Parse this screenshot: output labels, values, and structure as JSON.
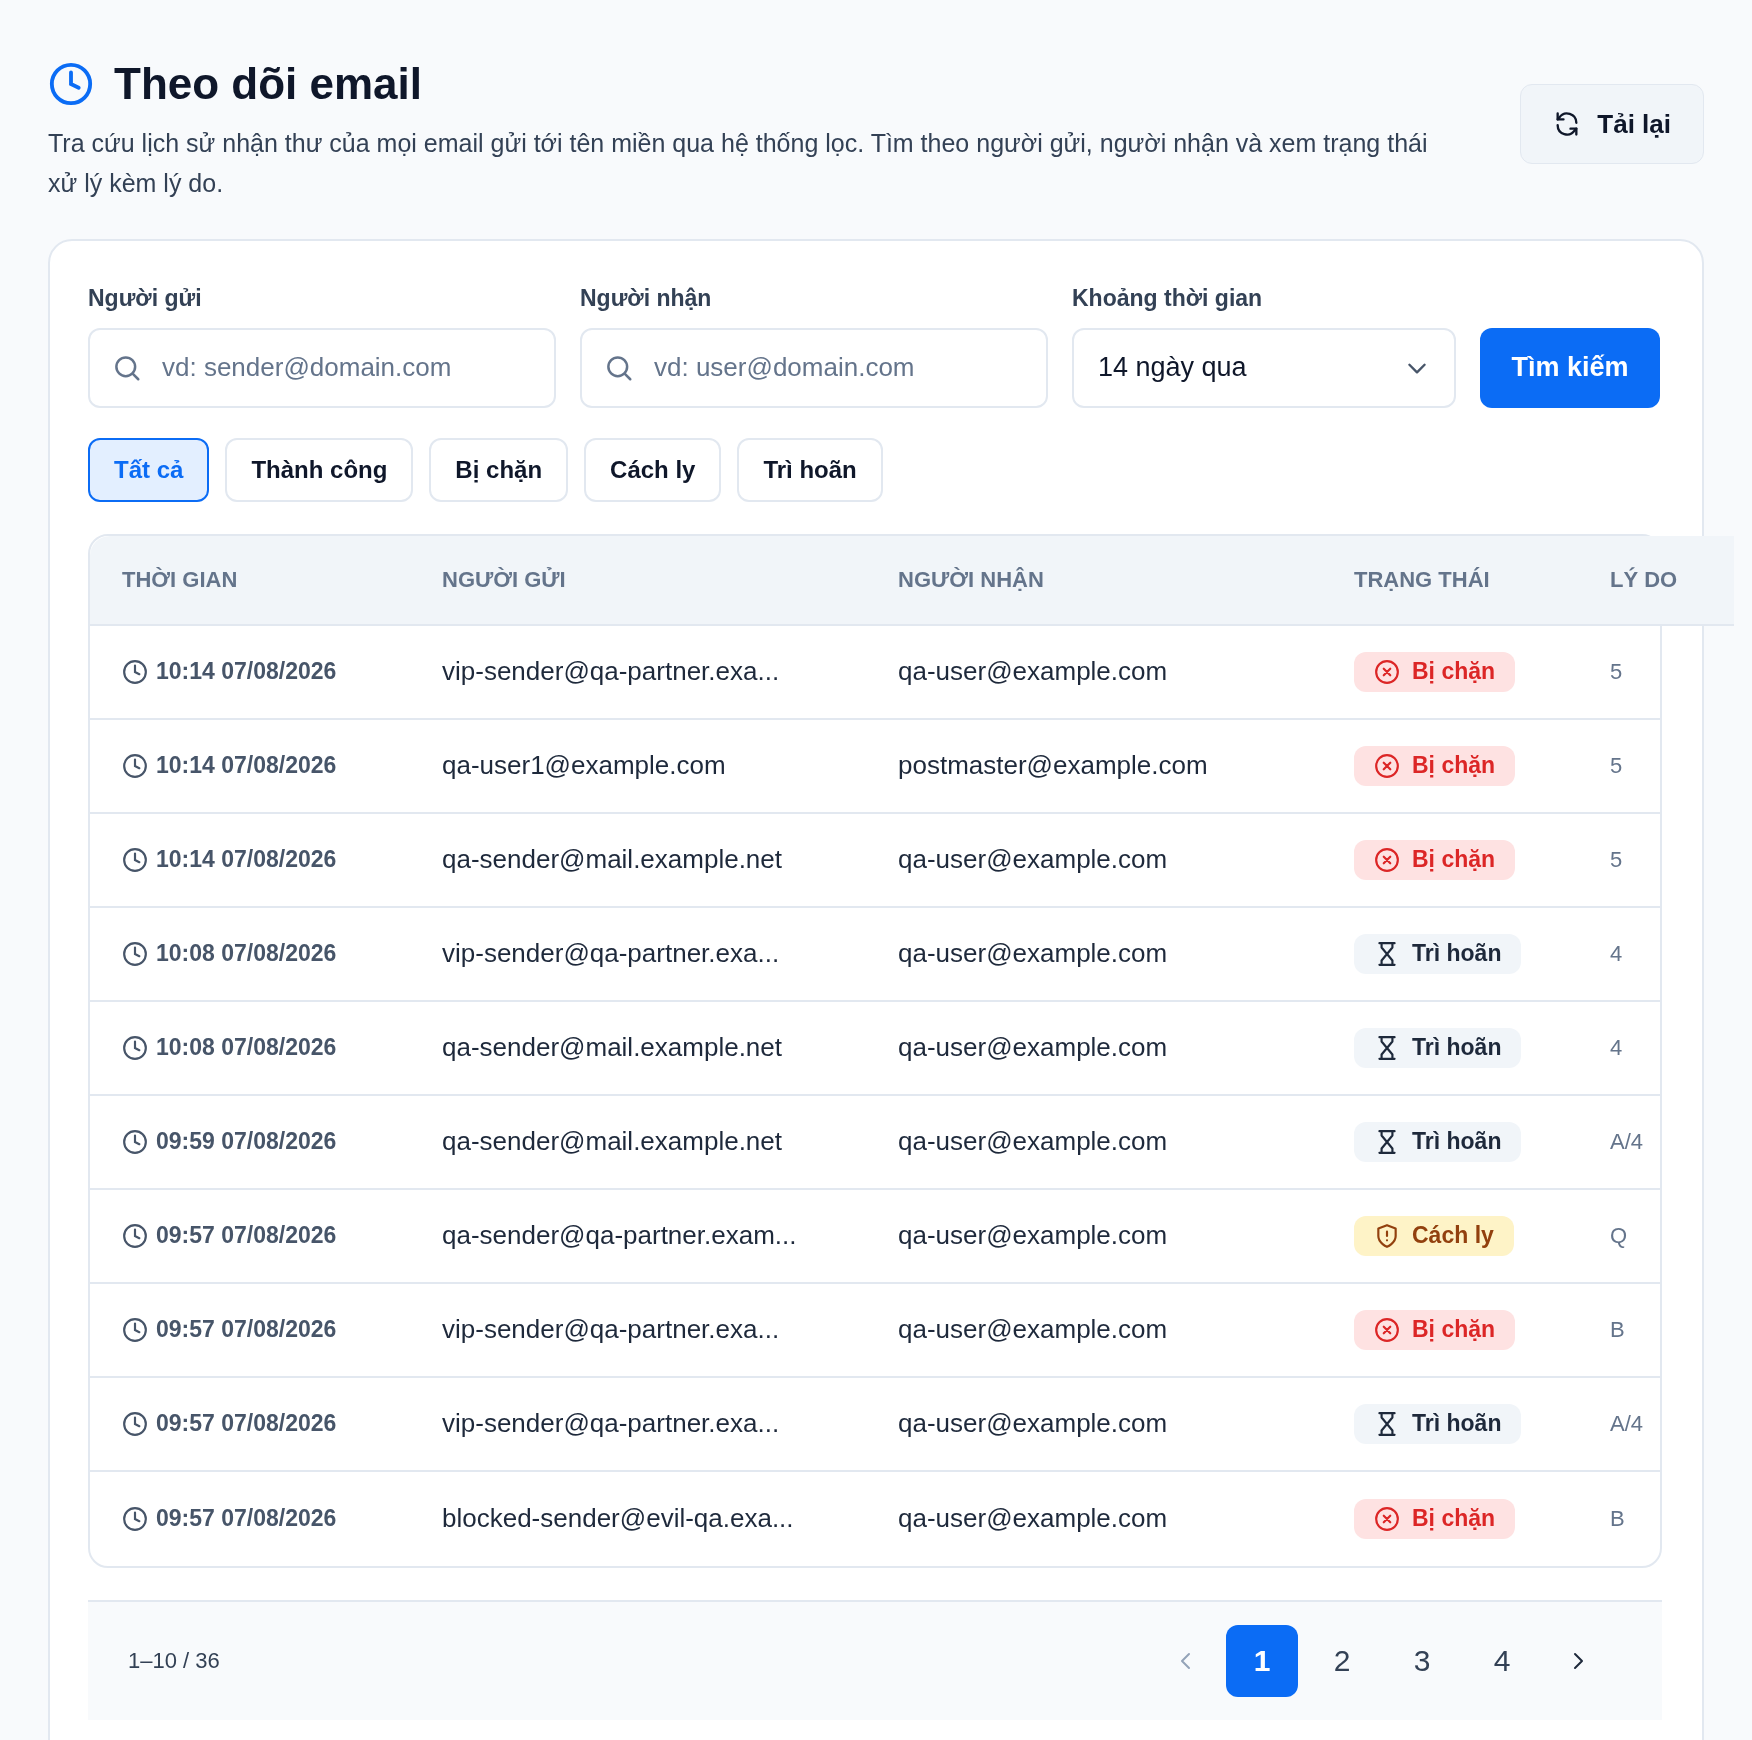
{
  "header": {
    "title": "Theo dõi email",
    "description": "Tra cứu lịch sử nhận thư của mọi email gửi tới tên miền qua hệ thống lọc. Tìm theo người gửi, người nhận và xem trạng thái xử lý kèm lý do.",
    "reload_button": "Tải lại"
  },
  "filters": {
    "sender": {
      "label": "Người gửi",
      "placeholder": "vd: sender@domain.com"
    },
    "recipient": {
      "label": "Người nhận",
      "placeholder": "vd: user@domain.com"
    },
    "period": {
      "label": "Khoảng thời gian",
      "value": "14 ngày qua"
    },
    "search_button": "Tìm kiếm"
  },
  "status_tabs": [
    {
      "label": "Tất cả",
      "selected": true
    },
    {
      "label": "Thành công",
      "selected": false
    },
    {
      "label": "Bị chặn",
      "selected": false
    },
    {
      "label": "Cách ly",
      "selected": false
    },
    {
      "label": "Trì hoãn",
      "selected": false
    }
  ],
  "table": {
    "columns": [
      "THỜI GIAN",
      "NGƯỜI GỬI",
      "NGƯỜI NHẬN",
      "TRẠNG THÁI",
      "LÝ DO"
    ],
    "rows": [
      {
        "time": "10:14 07/08/2026",
        "sender": "vip-sender@qa-partner.exa...",
        "recipient": "qa-user@example.com",
        "status": {
          "kind": "blocked",
          "label": "Bị chặn"
        },
        "reason": "5"
      },
      {
        "time": "10:14 07/08/2026",
        "sender": "qa-user1@example.com",
        "recipient": "postmaster@example.com",
        "status": {
          "kind": "blocked",
          "label": "Bị chặn"
        },
        "reason": "5"
      },
      {
        "time": "10:14 07/08/2026",
        "sender": "qa-sender@mail.example.net",
        "recipient": "qa-user@example.com",
        "status": {
          "kind": "blocked",
          "label": "Bị chặn"
        },
        "reason": "5"
      },
      {
        "time": "10:08 07/08/2026",
        "sender": "vip-sender@qa-partner.exa...",
        "recipient": "qa-user@example.com",
        "status": {
          "kind": "deferred",
          "label": "Trì hoãn"
        },
        "reason": "4"
      },
      {
        "time": "10:08 07/08/2026",
        "sender": "qa-sender@mail.example.net",
        "recipient": "qa-user@example.com",
        "status": {
          "kind": "deferred",
          "label": "Trì hoãn"
        },
        "reason": "4"
      },
      {
        "time": "09:59 07/08/2026",
        "sender": "qa-sender@mail.example.net",
        "recipient": "qa-user@example.com",
        "status": {
          "kind": "deferred",
          "label": "Trì hoãn"
        },
        "reason": "A/4"
      },
      {
        "time": "09:57 07/08/2026",
        "sender": "qa-sender@qa-partner.exam...",
        "recipient": "qa-user@example.com",
        "status": {
          "kind": "quarantine",
          "label": "Cách ly"
        },
        "reason": "Q"
      },
      {
        "time": "09:57 07/08/2026",
        "sender": "vip-sender@qa-partner.exa...",
        "recipient": "qa-user@example.com",
        "status": {
          "kind": "blocked",
          "label": "Bị chặn"
        },
        "reason": "B"
      },
      {
        "time": "09:57 07/08/2026",
        "sender": "vip-sender@qa-partner.exa...",
        "recipient": "qa-user@example.com",
        "status": {
          "kind": "deferred",
          "label": "Trì hoãn"
        },
        "reason": "A/4"
      },
      {
        "time": "09:57 07/08/2026",
        "sender": "blocked-sender@evil-qa.exa...",
        "recipient": "qa-user@example.com",
        "status": {
          "kind": "blocked",
          "label": "Bị chặn"
        },
        "reason": "B"
      }
    ]
  },
  "pagination": {
    "range": "1–10 / 36",
    "previous_disabled": true,
    "pages": [
      {
        "label": "1",
        "selected": true
      },
      {
        "label": "2",
        "selected": false
      },
      {
        "label": "3",
        "selected": false
      },
      {
        "label": "4",
        "selected": false
      }
    ]
  }
}
